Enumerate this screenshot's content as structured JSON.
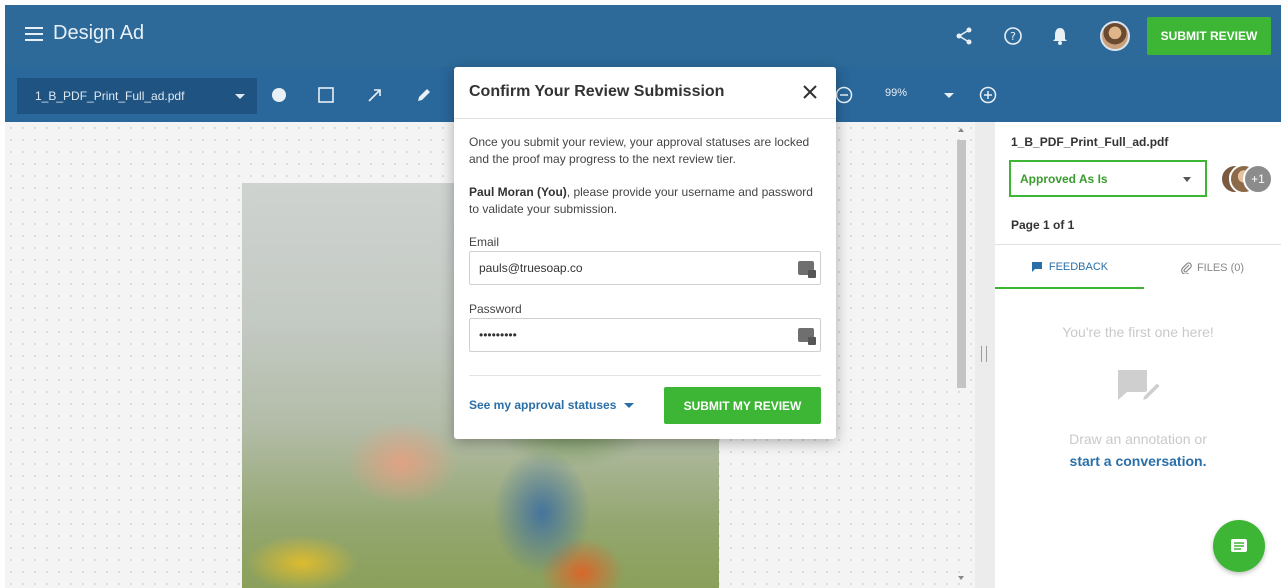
{
  "header": {
    "title": "Design Ad",
    "submit_label": "SUBMIT REVIEW",
    "icons": [
      "share-icon",
      "help-icon",
      "bell-icon",
      "avatar"
    ]
  },
  "toolbar": {
    "file_name": "1_B_PDF_Print_Full_ad.pdf",
    "zoom": "99%",
    "tools": [
      "circle-tool-icon",
      "rectangle-tool-icon",
      "arrow-tool-icon",
      "pencil-tool-icon",
      "zoom-out-icon",
      "zoom-in-icon"
    ]
  },
  "modal": {
    "title": "Confirm Your Review Submission",
    "description": "Once you submit your review, your approval statuses are locked and the proof may progress to the next review tier.",
    "user_name": "Paul Moran (You)",
    "instruction": ", please provide your username and password to validate your submission.",
    "email_label": "Email",
    "email_value": "pauls@truesoap.co",
    "password_label": "Password",
    "password_value": "•••••••••",
    "see_statuses": "See my approval statuses",
    "submit_label": "SUBMIT MY REVIEW"
  },
  "panel": {
    "file_name": "1_B_PDF_Print_Full_ad.pdf",
    "status": "Approved As Is",
    "extra_reviewers": "+1",
    "page_info": "Page 1 of 1",
    "tab_feedback": "FEEDBACK",
    "tab_files": "FILES (0)",
    "empty_title": "You're the first one here!",
    "empty_hint": "Draw an annotation or",
    "empty_link": "start a conversation."
  },
  "colors": {
    "header_bg": "#2d6a9a",
    "toolbar_bg": "#2a679a",
    "accent_green": "#3cb634",
    "link_blue": "#2a6fa8"
  }
}
